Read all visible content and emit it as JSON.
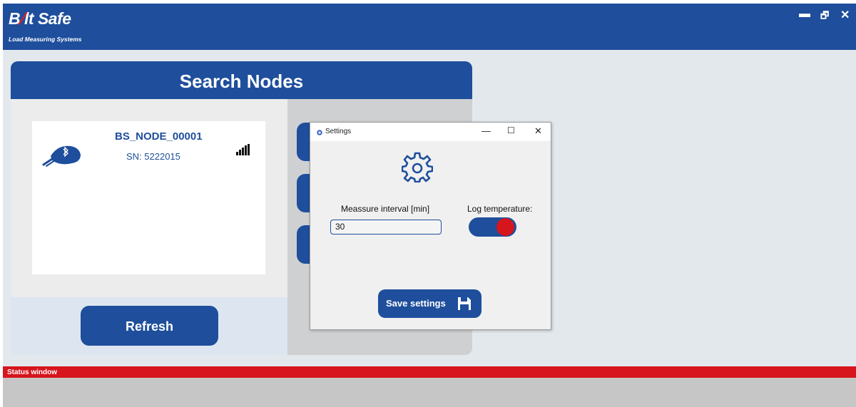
{
  "app": {
    "brand": {
      "prefix": "B",
      "slash": "/",
      "name": "lt Safe",
      "tagline": "Load Measuring Systems"
    },
    "window_controls": {
      "minimize": "▬",
      "restore": "🗗",
      "close": "✕"
    }
  },
  "search_panel": {
    "title": "Search Nodes",
    "nodes": [
      {
        "name": "BS_NODE_00001",
        "serial": "SN: 5222015",
        "signal_bars": 5,
        "icon": "bluetooth-usb-dongle-icon"
      }
    ],
    "refresh_label": "Refresh"
  },
  "status": {
    "label": "Status window"
  },
  "settings_dialog": {
    "title": "Settings",
    "controls": {
      "minimize": "—",
      "maximize": "☐",
      "close": "✕"
    },
    "interval": {
      "label": "Meassure interval [min]",
      "value": "30"
    },
    "log_temperature": {
      "label": "Log temperature:",
      "enabled": true
    },
    "save_label": "Save settings"
  },
  "colors": {
    "brand_blue": "#1e4e9c",
    "accent_red": "#d7151c",
    "background": "#e3e8ec"
  }
}
